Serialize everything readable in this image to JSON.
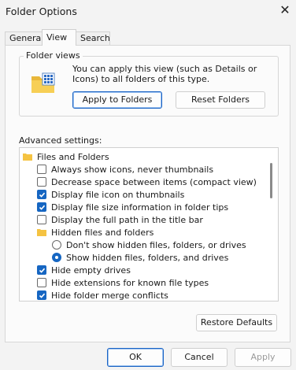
{
  "window": {
    "title": "Folder Options",
    "close_glyph": "✕"
  },
  "tabs": [
    {
      "label": "General",
      "active": false
    },
    {
      "label": "View",
      "active": true
    },
    {
      "label": "Search",
      "active": false
    }
  ],
  "folder_views": {
    "group_label": "Folder views",
    "description": "You can apply this view (such as Details or Icons) to all folders of this type.",
    "apply_button": "Apply to Folders",
    "reset_button": "Reset Folders",
    "icon": "folder-view-icon"
  },
  "advanced": {
    "label": "Advanced settings:",
    "items": [
      {
        "type": "folder",
        "label": "Files and Folders",
        "indent": 0
      },
      {
        "type": "checkbox",
        "label": "Always show icons, never thumbnails",
        "checked": false,
        "indent": 1
      },
      {
        "type": "checkbox",
        "label": "Decrease space between items (compact view)",
        "checked": false,
        "indent": 1
      },
      {
        "type": "checkbox",
        "label": "Display file icon on thumbnails",
        "checked": true,
        "indent": 1
      },
      {
        "type": "checkbox",
        "label": "Display file size information in folder tips",
        "checked": true,
        "indent": 1
      },
      {
        "type": "checkbox",
        "label": "Display the full path in the title bar",
        "checked": false,
        "indent": 1
      },
      {
        "type": "folder",
        "label": "Hidden files and folders",
        "indent": 1
      },
      {
        "type": "radio",
        "label": "Don't show hidden files, folders, or drives",
        "checked": false,
        "indent": 2
      },
      {
        "type": "radio",
        "label": "Show hidden files, folders, and drives",
        "checked": true,
        "indent": 2
      },
      {
        "type": "checkbox",
        "label": "Hide empty drives",
        "checked": true,
        "indent": 1
      },
      {
        "type": "checkbox",
        "label": "Hide extensions for known file types",
        "checked": false,
        "indent": 1
      },
      {
        "type": "checkbox",
        "label": "Hide folder merge conflicts",
        "checked": true,
        "indent": 1
      }
    ]
  },
  "restore_button": "Restore Defaults",
  "footer": {
    "ok": "OK",
    "cancel": "Cancel",
    "apply": "Apply"
  },
  "colors": {
    "accent": "#1666c2",
    "folder": "#f5c342"
  }
}
